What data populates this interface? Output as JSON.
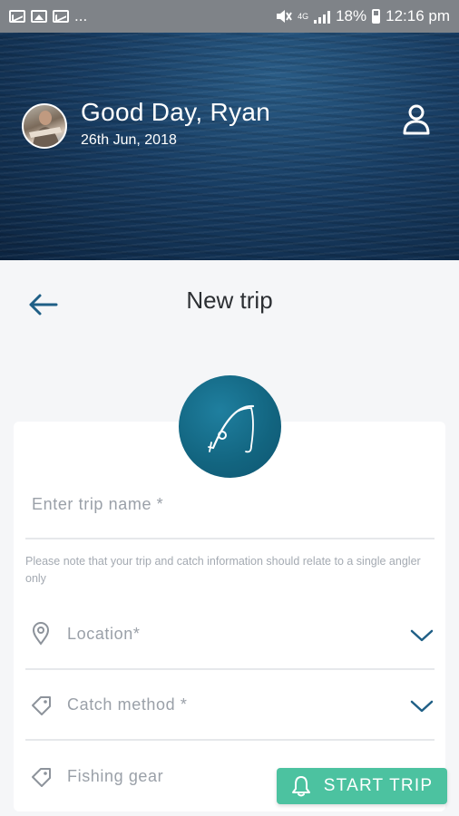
{
  "status_bar": {
    "dots": "...",
    "network": "4G",
    "battery": "18%",
    "time": "12:16 pm"
  },
  "header": {
    "greeting": "Good Day, Ryan",
    "date": "26th Jun, 2018"
  },
  "page": {
    "title": "New trip"
  },
  "form": {
    "trip_name_placeholder": "Enter trip name *",
    "note": "Please note that your trip and catch information should relate to a single angler only",
    "location_label": "Location*",
    "catch_method_label": "Catch method *",
    "fishing_gear_label": "Fishing gear"
  },
  "actions": {
    "start_trip": "START TRIP"
  },
  "colors": {
    "accent": "#12647f",
    "button": "#4cc2a0",
    "chevron": "#1f5f86"
  }
}
